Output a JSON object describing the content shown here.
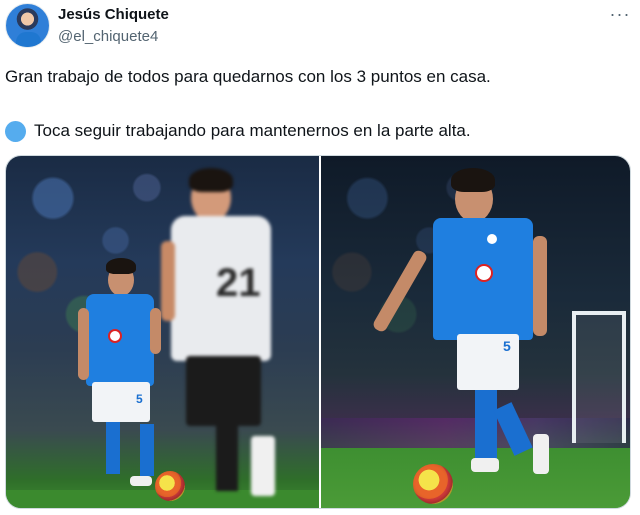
{
  "author": {
    "display_name": "Jesús Chiquete",
    "handle": "@el_chiquete4"
  },
  "tweet": {
    "line1": "Gran trabajo de todos para quedarnos con los 3 puntos en casa.",
    "line2": "Toca seguir trabajando para mantenernos en la parte alta.",
    "line2_emoji_icon": "blue-circle-icon"
  },
  "photos": {
    "left": {
      "player_number": "5",
      "opponent_number": "21"
    },
    "right": {
      "player_number": "5"
    }
  },
  "colors": {
    "text": "#0f1419",
    "secondary_text": "#536471",
    "cruz_azul_blue": "#1f7fe0"
  },
  "icons": {
    "more": "more-options-icon"
  }
}
